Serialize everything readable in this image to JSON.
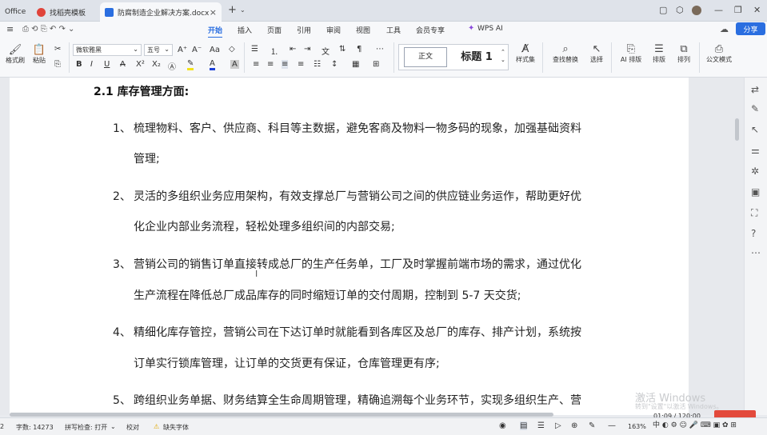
{
  "tabs": {
    "office": "Office",
    "template": "找稻壳模板",
    "document": "防腐制造企业解决方案.docx"
  },
  "ribbon_tabs": [
    "开始",
    "插入",
    "页面",
    "引用",
    "审阅",
    "视图",
    "工具",
    "会员专享",
    "WPS AI"
  ],
  "share_label": "分享",
  "toolbar": {
    "format_painter": "格式刷",
    "paste": "粘贴",
    "font_name": "微软雅黑",
    "font_size": "五号",
    "style_normal": "正文",
    "style_heading": "标题 1",
    "style_set": "样式集",
    "find_replace": "查找替换",
    "select": "选择",
    "ai_layout": "AI 排版",
    "layout": "排版",
    "arrange": "排列",
    "official_doc": "公文模式"
  },
  "document": {
    "heading": "2.1 库存管理方面:",
    "items": [
      {
        "num": "1、",
        "lines": [
          "梳理物料、客户、供应商、科目等主数据，避免客商及物料一物多码的现象，加强基础资料",
          "管理;"
        ]
      },
      {
        "num": "2、",
        "lines": [
          "灵活的多组织业务应用架构，有效支撑总厂与营销公司之间的供应链业务运作，帮助更好优",
          "化企业内部业务流程，轻松处理多组织间的内部交易;"
        ]
      },
      {
        "num": "3、",
        "lines": [
          "营销公司的销售订单直接转成总厂的生产任务单，工厂及时掌握前端市场的需求，通过优化",
          "生产流程在降低总厂成品库存的同时缩短订单的交付周期，控制到 5-7 天交货;"
        ]
      },
      {
        "num": "4、",
        "lines": [
          "精细化库存管控，营销公司在下达订单时就能看到各库区及总厂的库存、排产计划，系统按",
          "订单实行锁库管理，让订单的交货更有保证，仓库管理更有序;"
        ]
      },
      {
        "num": "5、",
        "lines": [
          "跨组织业务单据、财务结算全生命周期管理，精确追溯每个业务环节，实现多组织生产、营"
        ]
      }
    ]
  },
  "status": {
    "page": "2",
    "word_count": "字数: 14273",
    "spell_check": "拼写检查: 打开",
    "proofread": "校对",
    "missing_font": "缺失字体",
    "zoom": "163%"
  },
  "overlay": {
    "activate_title": "激活 Windows",
    "activate_sub": "转到\"设置\"以激活 Windows。",
    "time": "01:09 / 120:00",
    "ime": "中 ◐ ⚙ ☺ 🎤 ⌨ ▣ ✿ ⊞"
  },
  "colors": {
    "accent": "#2a6ee0",
    "record": "#e34a3c"
  }
}
